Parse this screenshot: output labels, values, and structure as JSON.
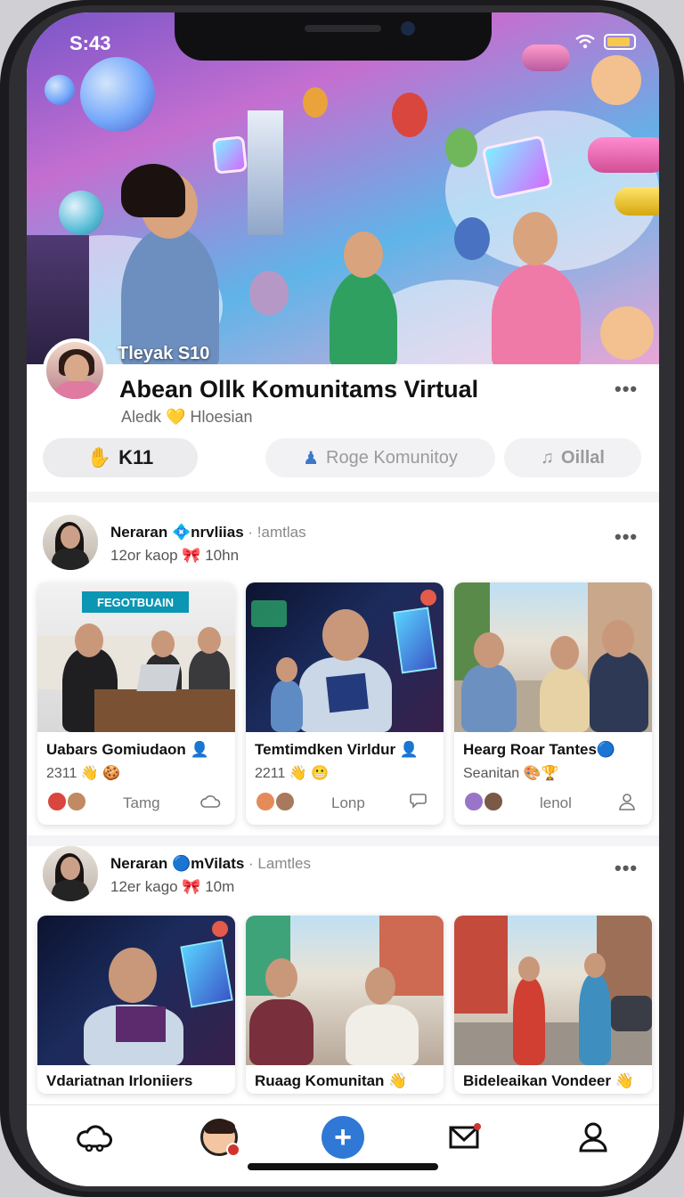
{
  "status_bar": {
    "time": "S:43"
  },
  "hero": {
    "caption": "Tleyak S10"
  },
  "community": {
    "title": "Abean Ollk Komunitams Virtual",
    "subtitle": "Aledk 💛 Hloesian"
  },
  "pills": [
    {
      "label": "K11",
      "icon": "hand-icon",
      "active": true
    },
    {
      "label": "Roge Komunitoy",
      "icon": "person-icon",
      "active": false
    },
    {
      "label": "Oillal",
      "icon": "music-icon",
      "active": false
    }
  ],
  "posts": [
    {
      "author": "Neraran 💠nrvliias",
      "author_suffix": "· !amtlas",
      "meta": "12or kaop 🎀 10hn",
      "cards": [
        {
          "title": "Uabars Gomiudaon 👤",
          "count": "2311 👋 🍪",
          "action": "Tamg",
          "sign": "FEGOTBUAIN",
          "action_icon": "cloud-icon"
        },
        {
          "title": "Temtimdken Virldur 👤",
          "count": "2211 👋 😬",
          "action": "Lonp",
          "action_icon": "share-icon"
        },
        {
          "title": "Hearg Roar Tantes🔵",
          "count": "Seanitan 🎨🏆",
          "action": "lenol",
          "action_icon": "person-icon"
        }
      ]
    },
    {
      "author": "Neraran 🔵mVilats",
      "author_suffix": "· Lamtles",
      "meta": "12er kago 🎀 10m",
      "cards": [
        {
          "title": "Vdariatnan Irloniiers"
        },
        {
          "title": "Ruaag Komunitan 👋"
        },
        {
          "title": "Bideleaikan Vondeer 👋"
        }
      ]
    }
  ],
  "nav": {
    "items": [
      "cloud-home-icon",
      "profile-avatar-icon",
      "create-plus-icon",
      "mail-icon",
      "person-icon"
    ],
    "plus_label": "+"
  },
  "colors": {
    "accent": "#2f78d6",
    "badge": "#d1342e"
  }
}
